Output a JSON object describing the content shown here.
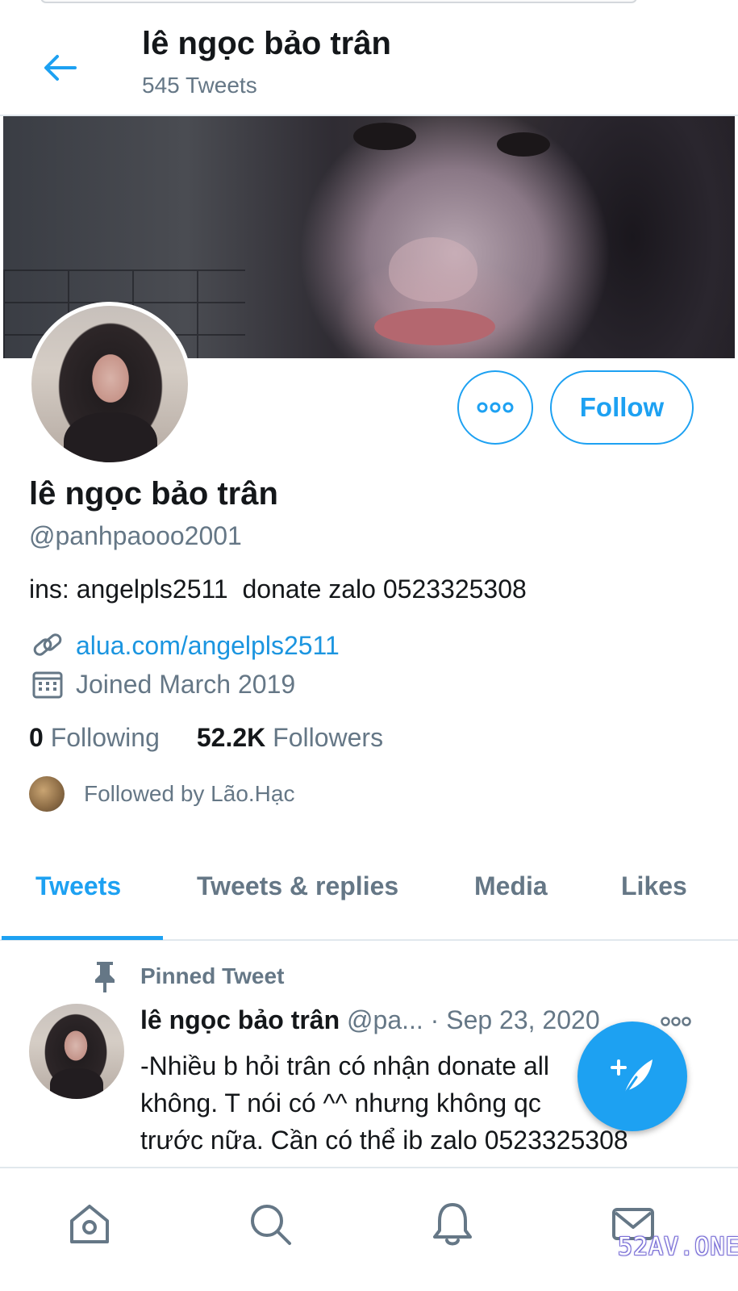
{
  "header": {
    "title": "lê ngọc bảo trân",
    "tweet_count": "545 Tweets"
  },
  "profile": {
    "name": "lê ngọc bảo trân",
    "handle": "@panhpaooo2001",
    "bio": "ins: angelpls2511  donate zalo 0523325308",
    "link": "alua.com/angelpls2511",
    "joined": "Joined March 2019",
    "following_count": "0",
    "following_label": "Following",
    "followers_count": "52.2K",
    "followers_label": "Followers",
    "followed_by": "Followed by Lão.Hạc"
  },
  "actions": {
    "follow_label": "Follow"
  },
  "tabs": [
    {
      "label": "Tweets",
      "active": true
    },
    {
      "label": "Tweets & replies",
      "active": false
    },
    {
      "label": "Media",
      "active": false
    },
    {
      "label": "Likes",
      "active": false
    }
  ],
  "pinned_tweet": {
    "badge": "Pinned Tweet",
    "author": "lê ngọc bảo trân",
    "handle": "@pa...",
    "separator": " · ",
    "date": "Sep 23, 2020",
    "lines": [
      "-Nhiều b hỏi trân có nhận donate all",
      "không. T nói có ^^ nhưng không qc",
      "trước nữa. Cần có thể ib zalo 0523325308"
    ]
  },
  "bottom_nav": [
    "home-icon",
    "search-icon",
    "bell-icon",
    "mail-icon"
  ],
  "watermark": "52AV.ONE",
  "colors": {
    "accent": "#1da1f2",
    "link": "#1b95e0",
    "secondary_text": "#657786",
    "primary_text": "#14171a"
  }
}
